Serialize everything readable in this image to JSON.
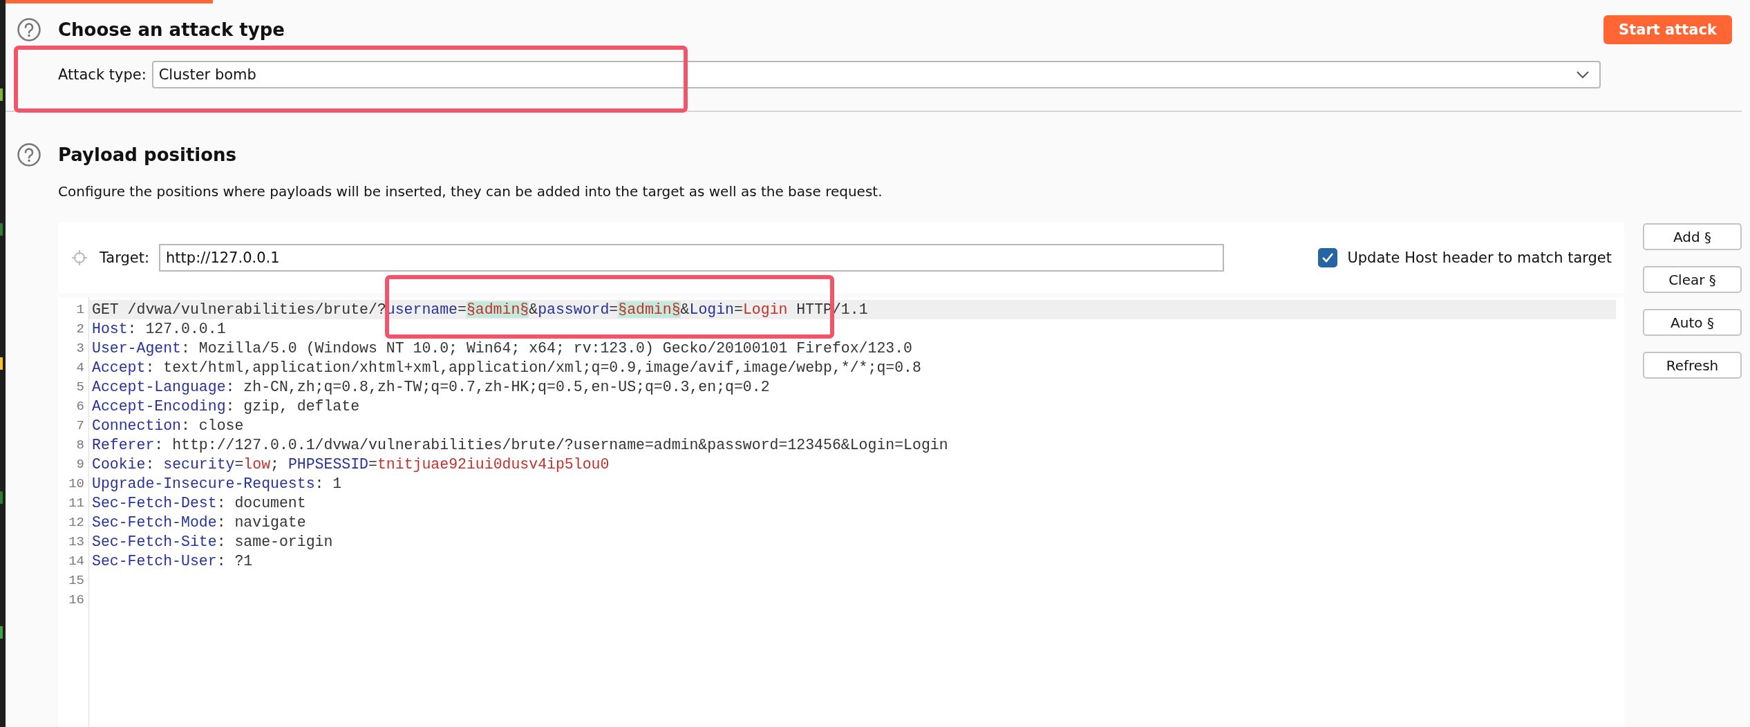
{
  "attack_type_section": {
    "title": "Choose an attack type",
    "label": "Attack type:",
    "value": "Cluster bomb",
    "start_button": "Start attack"
  },
  "payload_positions": {
    "title": "Payload positions",
    "description": "Configure the positions where payloads will be inserted, they can be added into the target as well as the base request.",
    "target_label": "Target:",
    "target_value": "http://127.0.0.1",
    "update_host": {
      "label": "Update Host header to match target",
      "checked": true
    },
    "editor": {
      "lines": [
        {
          "number": "1",
          "current": true,
          "segments": [
            {
              "kind": "plain",
              "text": "GET /dvwa/vulnerabilities/brute/?"
            },
            {
              "kind": "key",
              "text": "username"
            },
            {
              "kind": "plain",
              "text": "="
            },
            {
              "kind": "payload",
              "text": "§admin§"
            },
            {
              "kind": "plain",
              "text": "&"
            },
            {
              "kind": "key",
              "text": "password"
            },
            {
              "kind": "plain",
              "text": "="
            },
            {
              "kind": "payload",
              "text": "§admin§"
            },
            {
              "kind": "plain",
              "text": "&"
            },
            {
              "kind": "key",
              "text": "Login"
            },
            {
              "kind": "plain",
              "text": "="
            },
            {
              "kind": "value",
              "text": "Login"
            },
            {
              "kind": "plain",
              "text": " HTTP/1.1"
            }
          ]
        },
        {
          "number": "2",
          "current": false,
          "segments": [
            {
              "kind": "key",
              "text": "Host"
            },
            {
              "kind": "plain",
              "text": ": 127.0.0.1"
            }
          ]
        },
        {
          "number": "3",
          "current": false,
          "segments": [
            {
              "kind": "key",
              "text": "User-Agent"
            },
            {
              "kind": "plain",
              "text": ": Mozilla/5.0 (Windows NT 10.0; Win64; x64; rv:123.0) Gecko/20100101 Firefox/123.0"
            }
          ]
        },
        {
          "number": "4",
          "current": false,
          "segments": [
            {
              "kind": "key",
              "text": "Accept"
            },
            {
              "kind": "plain",
              "text": ": text/html,application/xhtml+xml,application/xml;q=0.9,image/avif,image/webp,*/*;q=0.8"
            }
          ]
        },
        {
          "number": "5",
          "current": false,
          "segments": [
            {
              "kind": "key",
              "text": "Accept-Language"
            },
            {
              "kind": "plain",
              "text": ": zh-CN,zh;q=0.8,zh-TW;q=0.7,zh-HK;q=0.5,en-US;q=0.3,en;q=0.2"
            }
          ]
        },
        {
          "number": "6",
          "current": false,
          "segments": [
            {
              "kind": "key",
              "text": "Accept-Encoding"
            },
            {
              "kind": "plain",
              "text": ": gzip, deflate"
            }
          ]
        },
        {
          "number": "7",
          "current": false,
          "segments": [
            {
              "kind": "key",
              "text": "Connection"
            },
            {
              "kind": "plain",
              "text": ": close"
            }
          ]
        },
        {
          "number": "8",
          "current": false,
          "segments": [
            {
              "kind": "key",
              "text": "Referer"
            },
            {
              "kind": "plain",
              "text": ": http://127.0.0.1/dvwa/vulnerabilities/brute/?username=admin&password=123456&Login=Login"
            }
          ]
        },
        {
          "number": "9",
          "current": false,
          "segments": [
            {
              "kind": "key",
              "text": "Cookie"
            },
            {
              "kind": "plain",
              "text": ": "
            },
            {
              "kind": "key",
              "text": "security"
            },
            {
              "kind": "plain",
              "text": "="
            },
            {
              "kind": "value",
              "text": "low"
            },
            {
              "kind": "plain",
              "text": "; "
            },
            {
              "kind": "key",
              "text": "PHPSESSID"
            },
            {
              "kind": "plain",
              "text": "="
            },
            {
              "kind": "value",
              "text": "tnitjuae92iui0dusv4ip5lou0"
            }
          ]
        },
        {
          "number": "10",
          "current": false,
          "segments": [
            {
              "kind": "key",
              "text": "Upgrade-Insecure-Requests"
            },
            {
              "kind": "plain",
              "text": ": 1"
            }
          ]
        },
        {
          "number": "11",
          "current": false,
          "segments": [
            {
              "kind": "key",
              "text": "Sec-Fetch-Dest"
            },
            {
              "kind": "plain",
              "text": ": document"
            }
          ]
        },
        {
          "number": "12",
          "current": false,
          "segments": [
            {
              "kind": "key",
              "text": "Sec-Fetch-Mode"
            },
            {
              "kind": "plain",
              "text": ": navigate"
            }
          ]
        },
        {
          "number": "13",
          "current": false,
          "segments": [
            {
              "kind": "key",
              "text": "Sec-Fetch-Site"
            },
            {
              "kind": "plain",
              "text": ": same-origin"
            }
          ]
        },
        {
          "number": "14",
          "current": false,
          "segments": [
            {
              "kind": "key",
              "text": "Sec-Fetch-User"
            },
            {
              "kind": "plain",
              "text": ": ?1"
            }
          ]
        },
        {
          "number": "15",
          "current": false
        },
        {
          "number": "16",
          "current": false
        }
      ]
    },
    "buttons": [
      "Add §",
      "Clear §",
      "Auto §",
      "Refresh"
    ]
  }
}
